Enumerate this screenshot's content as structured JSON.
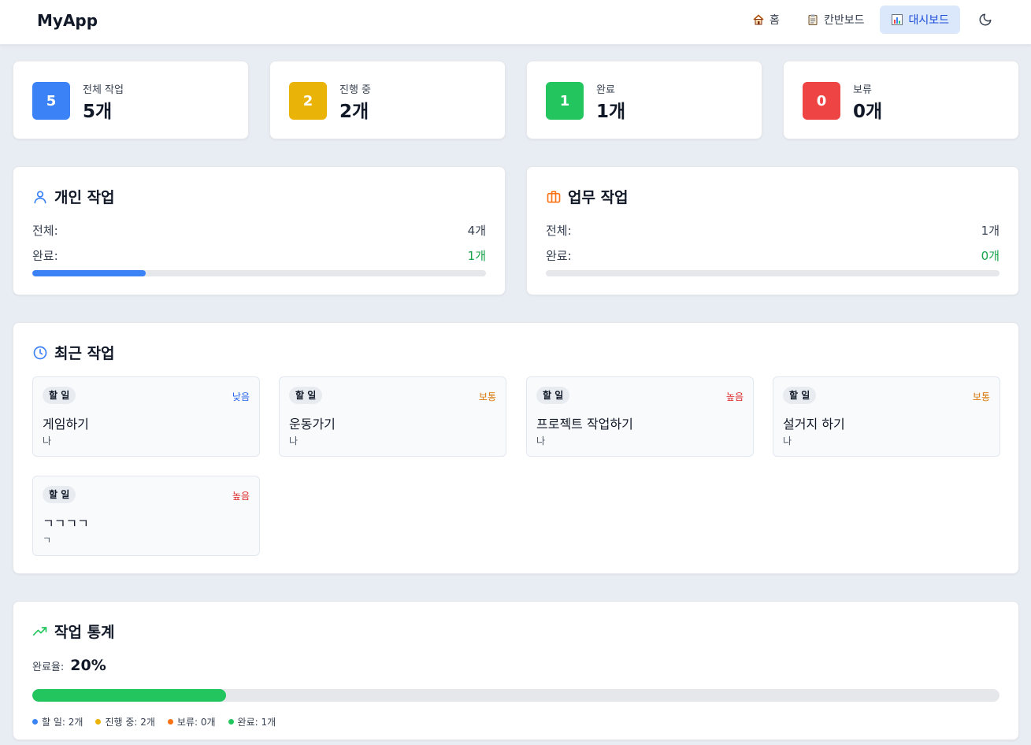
{
  "app": {
    "title": "MyApp"
  },
  "nav": [
    {
      "label": "홈",
      "icon": "home-icon"
    },
    {
      "label": "칸반보드",
      "icon": "clipboard-icon"
    },
    {
      "label": "대시보드",
      "icon": "bar-chart-icon",
      "active": true
    }
  ],
  "theme_toggle": {
    "icon": "moon-icon"
  },
  "stats": [
    {
      "badge": "5",
      "label": "전체 작업",
      "value": "5개",
      "color": "#3b82f6"
    },
    {
      "badge": "2",
      "label": "진행 중",
      "value": "2개",
      "color": "#eab308"
    },
    {
      "badge": "1",
      "label": "완료",
      "value": "1개",
      "color": "#22c55e"
    },
    {
      "badge": "0",
      "label": "보류",
      "value": "0개",
      "color": "#ef4444"
    }
  ],
  "personal": {
    "title": "개인 작업",
    "icon": "user-icon",
    "total_label": "전체:",
    "total_value": "4개",
    "done_label": "완료:",
    "done_value": "1개",
    "progress": 0.25
  },
  "work": {
    "title": "업무 작업",
    "icon": "briefcase-icon",
    "total_label": "전체:",
    "total_value": "1개",
    "done_label": "완료:",
    "done_value": "0개",
    "progress": 0
  },
  "recent": {
    "title": "최근 작업",
    "icon": "clock-icon",
    "tasks": [
      {
        "status": "할 일",
        "priority": "낮음",
        "priority_color": "#2563eb",
        "title": "게임하기",
        "owner": "나"
      },
      {
        "status": "할 일",
        "priority": "보통",
        "priority_color": "#d97706",
        "title": "운동가기",
        "owner": "나"
      },
      {
        "status": "할 일",
        "priority": "높음",
        "priority_color": "#dc2626",
        "title": "프로젝트 작업하기",
        "owner": "나"
      },
      {
        "status": "할 일",
        "priority": "보통",
        "priority_color": "#d97706",
        "title": "설거지 하기",
        "owner": "나"
      },
      {
        "status": "할 일",
        "priority": "높음",
        "priority_color": "#dc2626",
        "title": "ㄱㄱㄱㄱ",
        "owner": "ㄱ"
      }
    ]
  },
  "statistics": {
    "title": "작업 통계",
    "icon": "trending-up-icon",
    "rate_label": "완료율:",
    "rate_value": "20%",
    "progress": 0.2,
    "legend": [
      {
        "label": "할 일: 2개",
        "color": "#3b82f6"
      },
      {
        "label": "진행 중: 2개",
        "color": "#eab308"
      },
      {
        "label": "보류: 0개",
        "color": "#f97316"
      },
      {
        "label": "완료: 1개",
        "color": "#22c55e"
      }
    ]
  }
}
